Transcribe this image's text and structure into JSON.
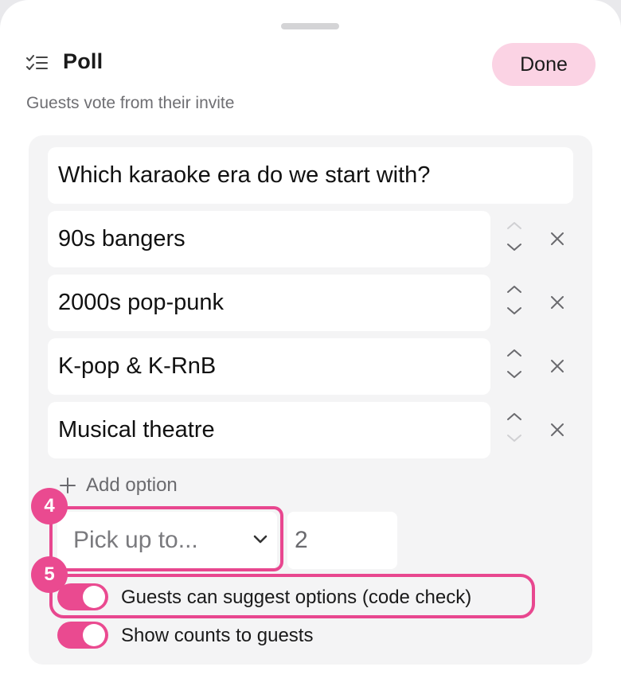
{
  "header": {
    "title": "Poll",
    "done_label": "Done",
    "subtitle": "Guests vote from their invite",
    "icon": "checklist-icon"
  },
  "poll": {
    "question": "Which karaoke era do we start with?",
    "options": [
      {
        "label": "90s bangers"
      },
      {
        "label": "2000s pop-punk"
      },
      {
        "label": "K-pop & K-RnB"
      },
      {
        "label": "Musical theatre"
      }
    ],
    "add_option_label": "Add option"
  },
  "limit": {
    "select_value": "Pick up to...",
    "number_value": "2"
  },
  "toggles": {
    "suggest_label": "Guests can suggest options (code check)",
    "suggest_on": true,
    "counts_label": "Show counts to guests",
    "counts_on": true
  },
  "annotations": {
    "badge_4": "4",
    "badge_5": "5"
  },
  "colors": {
    "accent": "#ea4a90",
    "done_bg": "#fbd3e4",
    "panel_bg": "#f4f4f5"
  }
}
